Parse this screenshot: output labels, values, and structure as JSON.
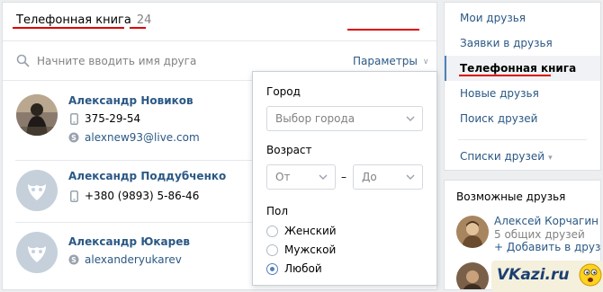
{
  "header": {
    "title": "Телефонная книга",
    "count": "24"
  },
  "search": {
    "placeholder": "Начните вводить имя друга",
    "params_label": "Параметры"
  },
  "friends": [
    {
      "name": "Александр Новиков",
      "phone": "375-29-54",
      "skype": "alexnew93@live.com"
    },
    {
      "name": "Александр Поддубченко",
      "phone": "+380 (9893) 5-86-46"
    },
    {
      "name": "Александр Юкарев",
      "skype": "alexanderyukarev"
    }
  ],
  "filters": {
    "city_label": "Город",
    "city_placeholder": "Выбор города",
    "age_label": "Возраст",
    "age_from": "От",
    "age_dash": "–",
    "age_to": "До",
    "sex_label": "Пол",
    "sex_options": [
      "Женский",
      "Мужской",
      "Любой"
    ],
    "sex_selected": "Любой"
  },
  "menu": {
    "items": [
      "Мои друзья",
      "Заявки в друзья",
      "Телефонная книга",
      "Новые друзья",
      "Поиск друзей",
      "Списки друзей"
    ],
    "active": "Телефонная книга"
  },
  "possible_friends": {
    "title": "Возможные друзья",
    "person": {
      "name": "Алексей Корчагин",
      "mutual": "5 общих друзей",
      "add": "+ Добавить в друзья"
    }
  },
  "watermark": "VKazi.ru",
  "colors": {
    "link": "#2a5885",
    "accent": "#5181b8",
    "highlight_underline": "#dd0000"
  }
}
